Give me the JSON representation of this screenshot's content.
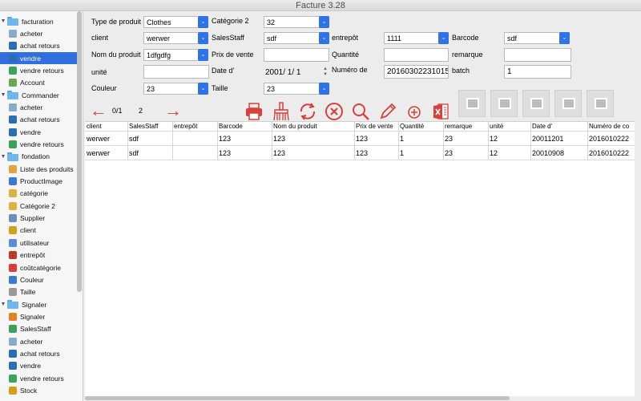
{
  "window": {
    "title": "Facture 3.28"
  },
  "sidebar": {
    "items": [
      {
        "label": "facturation",
        "type": "group",
        "expanded": true
      },
      {
        "label": "acheter",
        "type": "item",
        "color": "#8aa9c9"
      },
      {
        "label": "achat retours",
        "type": "item",
        "color": "#2c6db5"
      },
      {
        "label": "vendre",
        "type": "item",
        "selected": true,
        "color": "#2c6db5"
      },
      {
        "label": "vendre retours",
        "type": "item",
        "color": "#3aa25c"
      },
      {
        "label": "Account",
        "type": "item",
        "color": "#6aa84f"
      },
      {
        "label": "Commander",
        "type": "group",
        "expanded": true
      },
      {
        "label": "acheter",
        "type": "item",
        "color": "#8aa9c9"
      },
      {
        "label": "achat retours",
        "type": "item",
        "color": "#2c6db5"
      },
      {
        "label": "vendre",
        "type": "item",
        "color": "#2c6db5"
      },
      {
        "label": "vendre retours",
        "type": "item",
        "color": "#3aa25c"
      },
      {
        "label": "fondation",
        "type": "group",
        "expanded": true
      },
      {
        "label": "Liste des produits",
        "type": "item",
        "color": "#e6a23c"
      },
      {
        "label": "ProductImage",
        "type": "item",
        "color": "#3c78d8"
      },
      {
        "label": "catégorie",
        "type": "item",
        "color": "#e0b040"
      },
      {
        "label": "Catégorie 2",
        "type": "item",
        "color": "#e0b040"
      },
      {
        "label": "Supplier",
        "type": "item",
        "color": "#6c8ebf"
      },
      {
        "label": "client",
        "type": "item",
        "color": "#d4a017"
      },
      {
        "label": "utilisateur",
        "type": "item",
        "color": "#5b8dd6"
      },
      {
        "label": "entrepôt",
        "type": "item",
        "color": "#c0392b"
      },
      {
        "label": "coûtcatégorie",
        "type": "item",
        "color": "#e03c31"
      },
      {
        "label": "Couleur",
        "type": "item",
        "color": "#3c78d8"
      },
      {
        "label": "Taille",
        "type": "item",
        "color": "#999999"
      },
      {
        "label": "Signaler",
        "type": "group",
        "expanded": true
      },
      {
        "label": "Signaler",
        "type": "item",
        "color": "#e67e22"
      },
      {
        "label": "SalesStaff",
        "type": "item",
        "color": "#3aa25c"
      },
      {
        "label": "acheter",
        "type": "item",
        "color": "#8aa9c9"
      },
      {
        "label": "achat retours",
        "type": "item",
        "color": "#2c6db5"
      },
      {
        "label": "vendre",
        "type": "item",
        "color": "#2c6db5"
      },
      {
        "label": "vendre retours",
        "type": "item",
        "color": "#3aa25c"
      },
      {
        "label": "Stock",
        "type": "item",
        "color": "#d4a017"
      }
    ]
  },
  "form": {
    "type_produit": {
      "label": "Type de produit",
      "value": "Clothes"
    },
    "categorie2": {
      "label": "Catégorie 2",
      "value": "32"
    },
    "client": {
      "label": "client",
      "value": "werwer"
    },
    "salesstaff": {
      "label": "SalesStaff",
      "value": "sdf"
    },
    "entrepot": {
      "label": "entrepôt",
      "value": "1111"
    },
    "barcode": {
      "label": "Barcode",
      "value": "sdf"
    },
    "nom_produit": {
      "label": "Nom du produit",
      "value": "1dfgdfg"
    },
    "prix_vente": {
      "label": "Prix de vente",
      "value": ""
    },
    "quantite": {
      "label": "Quantité",
      "value": ""
    },
    "remarque": {
      "label": "remarque",
      "value": ""
    },
    "unite": {
      "label": "unité",
      "value": ""
    },
    "date": {
      "label": "Date d'",
      "value": "2001/  1/  1"
    },
    "numero": {
      "label": "Numéro de",
      "value": "20160302231015"
    },
    "batch": {
      "label": "batch",
      "value": "1"
    },
    "couleur": {
      "label": "Couleur",
      "value": "23"
    },
    "taille": {
      "label": "Taille",
      "value": "23"
    }
  },
  "toolbar": {
    "page_current": "0/1",
    "page_total": "2",
    "colors": {
      "red": "#d9403a"
    }
  },
  "table": {
    "columns": [
      "client",
      "SalesStaff",
      "entrepôt",
      "Barcode",
      "Nom du produit",
      "Prix de vente",
      "Quantité",
      "remarque",
      "unité",
      "Date d'",
      "Numéro de co"
    ],
    "rows": [
      [
        "werwer",
        "sdf",
        "",
        "123",
        "123",
        "123",
        "1",
        "23",
        "12",
        "20011201",
        "2016010222"
      ],
      [
        "werwer",
        "sdf",
        "",
        "123",
        "123",
        "123",
        "1",
        "23",
        "12",
        "20010908",
        "2016010222"
      ]
    ]
  }
}
